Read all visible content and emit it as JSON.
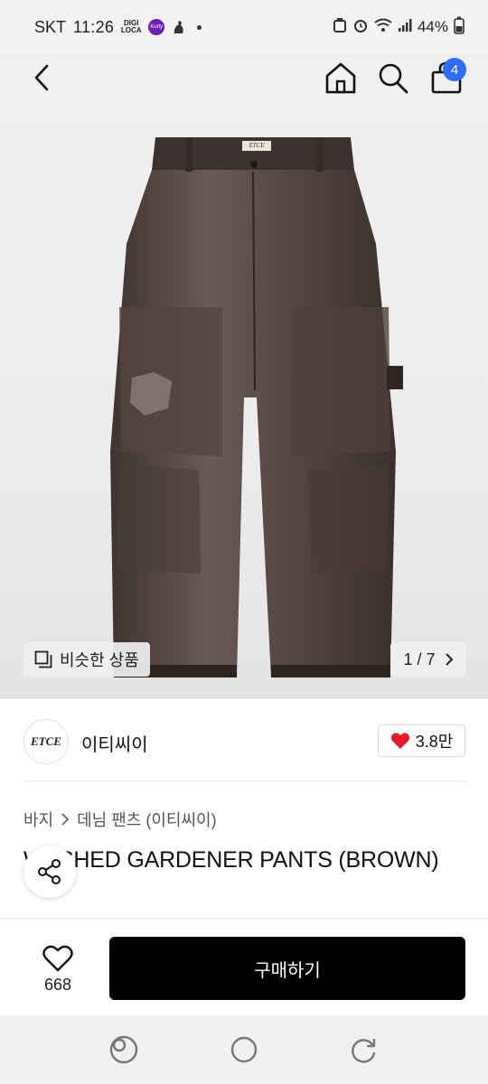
{
  "status_bar": {
    "carrier": "SKT",
    "time": "11:26",
    "digi_icon_text": "DIGI LOCA",
    "kurly_icon_text": "Kurly",
    "battery": "44%"
  },
  "header": {
    "cart_count": "4"
  },
  "gallery": {
    "similar_label": "비슷한 상품",
    "page_current": "1",
    "page_separator": "/",
    "page_total": "7",
    "label_tag": "ETCE"
  },
  "brand": {
    "logo_text": "ETCE",
    "name": "이티씨이",
    "likes": "3.8만"
  },
  "breadcrumb": {
    "category": "바지",
    "subcategory": "데님 팬츠 (이티씨이)"
  },
  "product": {
    "title": "WASHED GARDENER PANTS (BROWN)"
  },
  "action_bar": {
    "wish_count": "668",
    "buy_label": "구매하기"
  },
  "icons": {
    "back": "back-arrow-icon",
    "home": "home-icon",
    "search": "search-icon",
    "cart": "shopping-bag-icon",
    "similar": "similar-items-icon",
    "heart": "heart-icon",
    "share": "share-icon"
  },
  "colors": {
    "accent_blue": "#2d6df6",
    "like_red": "#e8192c",
    "buy_button": "#000000",
    "pants_brown": "#4a3d38"
  }
}
